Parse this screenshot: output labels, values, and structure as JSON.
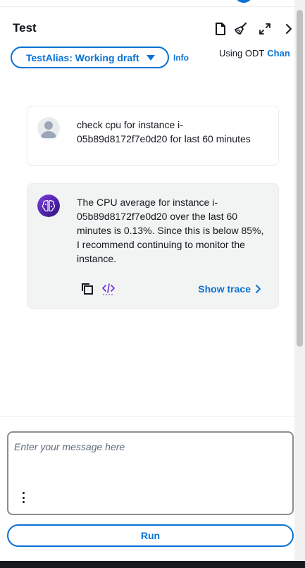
{
  "header": {
    "title": "Test",
    "tools": [
      "file-icon",
      "broom-icon",
      "expand-icon",
      "chevron-right-icon"
    ]
  },
  "alias": {
    "label": "TestAlias: Working draft",
    "info": "Info",
    "using_text": "Using ODT",
    "change_link": "Chan"
  },
  "conversation": {
    "user_message": "check cpu for instance i-05b89d8172f7e0d20 for last 60 minutes",
    "bot_message": "The CPU average for instance i-05b89d8172f7e0d20 over the last 60 minutes is 0.13%. Since this is below 85%, I recommend continuing to monitor the instance.",
    "show_trace": "Show trace"
  },
  "composer": {
    "placeholder": "Enter your message here",
    "value": "",
    "run_label": "Run"
  },
  "colors": {
    "accent": "#0972d3",
    "bot_avatar": "#4b1fa3",
    "bubble_bg": "#f2f3f3"
  }
}
